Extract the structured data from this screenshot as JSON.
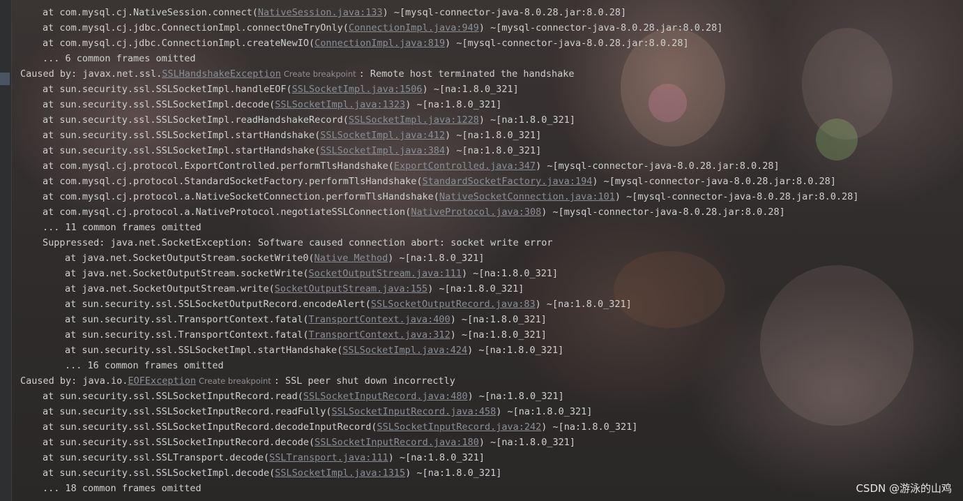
{
  "lines": [
    {
      "indent": 1,
      "pre": "at com.mysql.cj.NativeSession.connect(",
      "link": "NativeSession.java:133",
      "post": ") ~[mysql-connector-java-8.0.28.jar:8.0.28]"
    },
    {
      "indent": 1,
      "pre": "at com.mysql.cj.jdbc.ConnectionImpl.connectOneTryOnly(",
      "link": "ConnectionImpl.java:949",
      "post": ") ~[mysql-connector-java-8.0.28.jar:8.0.28]"
    },
    {
      "indent": 1,
      "pre": "at com.mysql.cj.jdbc.ConnectionImpl.createNewIO(",
      "link": "ConnectionImpl.java:819",
      "post": ") ~[mysql-connector-java-8.0.28.jar:8.0.28]"
    },
    {
      "indent": 1,
      "pre": "... 6 common frames omitted"
    },
    {
      "indent": 0,
      "pre": "Caused by: javax.net.ssl.",
      "link": "SSLHandshakeException",
      "hint": "Create breakpoint",
      "post": ": Remote host terminated the handshake"
    },
    {
      "indent": 1,
      "pre": "at sun.security.ssl.SSLSocketImpl.handleEOF(",
      "link": "SSLSocketImpl.java:1506",
      "post": ") ~[na:1.8.0_321]"
    },
    {
      "indent": 1,
      "pre": "at sun.security.ssl.SSLSocketImpl.decode(",
      "link": "SSLSocketImpl.java:1323",
      "post": ") ~[na:1.8.0_321]"
    },
    {
      "indent": 1,
      "pre": "at sun.security.ssl.SSLSocketImpl.readHandshakeRecord(",
      "link": "SSLSocketImpl.java:1228",
      "post": ") ~[na:1.8.0_321]"
    },
    {
      "indent": 1,
      "pre": "at sun.security.ssl.SSLSocketImpl.startHandshake(",
      "link": "SSLSocketImpl.java:412",
      "post": ") ~[na:1.8.0_321]"
    },
    {
      "indent": 1,
      "pre": "at sun.security.ssl.SSLSocketImpl.startHandshake(",
      "link": "SSLSocketImpl.java:384",
      "post": ") ~[na:1.8.0_321]"
    },
    {
      "indent": 1,
      "pre": "at com.mysql.cj.protocol.ExportControlled.performTlsHandshake(",
      "link": "ExportControlled.java:347",
      "post": ") ~[mysql-connector-java-8.0.28.jar:8.0.28]"
    },
    {
      "indent": 1,
      "pre": "at com.mysql.cj.protocol.StandardSocketFactory.performTlsHandshake(",
      "link": "StandardSocketFactory.java:194",
      "post": ") ~[mysql-connector-java-8.0.28.jar:8.0.28]"
    },
    {
      "indent": 1,
      "pre": "at com.mysql.cj.protocol.a.NativeSocketConnection.performTlsHandshake(",
      "link": "NativeSocketConnection.java:101",
      "post": ") ~[mysql-connector-java-8.0.28.jar:8.0.28]"
    },
    {
      "indent": 1,
      "pre": "at com.mysql.cj.protocol.a.NativeProtocol.negotiateSSLConnection(",
      "link": "NativeProtocol.java:308",
      "post": ") ~[mysql-connector-java-8.0.28.jar:8.0.28]"
    },
    {
      "indent": 1,
      "pre": "... 11 common frames omitted"
    },
    {
      "indent": 1,
      "pre": "Suppressed: java.net.SocketException: Software caused connection abort: socket write error"
    },
    {
      "indent": 2,
      "pre": "at java.net.SocketOutputStream.socketWrite0(",
      "link": "Native Method",
      "post": ") ~[na:1.8.0_321]"
    },
    {
      "indent": 2,
      "pre": "at java.net.SocketOutputStream.socketWrite(",
      "link": "SocketOutputStream.java:111",
      "post": ") ~[na:1.8.0_321]"
    },
    {
      "indent": 2,
      "pre": "at java.net.SocketOutputStream.write(",
      "link": "SocketOutputStream.java:155",
      "post": ") ~[na:1.8.0_321]"
    },
    {
      "indent": 2,
      "pre": "at sun.security.ssl.SSLSocketOutputRecord.encodeAlert(",
      "link": "SSLSocketOutputRecord.java:83",
      "post": ") ~[na:1.8.0_321]"
    },
    {
      "indent": 2,
      "pre": "at sun.security.ssl.TransportContext.fatal(",
      "link": "TransportContext.java:400",
      "post": ") ~[na:1.8.0_321]"
    },
    {
      "indent": 2,
      "pre": "at sun.security.ssl.TransportContext.fatal(",
      "link": "TransportContext.java:312",
      "post": ") ~[na:1.8.0_321]"
    },
    {
      "indent": 2,
      "pre": "at sun.security.ssl.SSLSocketImpl.startHandshake(",
      "link": "SSLSocketImpl.java:424",
      "post": ") ~[na:1.8.0_321]"
    },
    {
      "indent": 2,
      "pre": "... 16 common frames omitted"
    },
    {
      "indent": 0,
      "pre": "Caused by: java.io.",
      "link": "EOFException",
      "hint": "Create breakpoint",
      "post": ": SSL peer shut down incorrectly"
    },
    {
      "indent": 1,
      "pre": "at sun.security.ssl.SSLSocketInputRecord.read(",
      "link": "SSLSocketInputRecord.java:480",
      "post": ") ~[na:1.8.0_321]"
    },
    {
      "indent": 1,
      "pre": "at sun.security.ssl.SSLSocketInputRecord.readFully(",
      "link": "SSLSocketInputRecord.java:458",
      "post": ") ~[na:1.8.0_321]"
    },
    {
      "indent": 1,
      "pre": "at sun.security.ssl.SSLSocketInputRecord.decodeInputRecord(",
      "link": "SSLSocketInputRecord.java:242",
      "post": ") ~[na:1.8.0_321]"
    },
    {
      "indent": 1,
      "pre": "at sun.security.ssl.SSLSocketInputRecord.decode(",
      "link": "SSLSocketInputRecord.java:180",
      "post": ") ~[na:1.8.0_321]"
    },
    {
      "indent": 1,
      "pre": "at sun.security.ssl.SSLTransport.decode(",
      "link": "SSLTransport.java:111",
      "post": ") ~[na:1.8.0_321]"
    },
    {
      "indent": 1,
      "pre": "at sun.security.ssl.SSLSocketImpl.decode(",
      "link": "SSLSocketImpl.java:1315",
      "post": ") ~[na:1.8.0_321]"
    },
    {
      "indent": 1,
      "pre": "... 18 common frames omitted"
    }
  ],
  "watermark": "CSDN @游泳的山鸡",
  "colors": {
    "text": "#d0d0d0",
    "link": "#8a8f96",
    "hint": "#8d8f92"
  }
}
